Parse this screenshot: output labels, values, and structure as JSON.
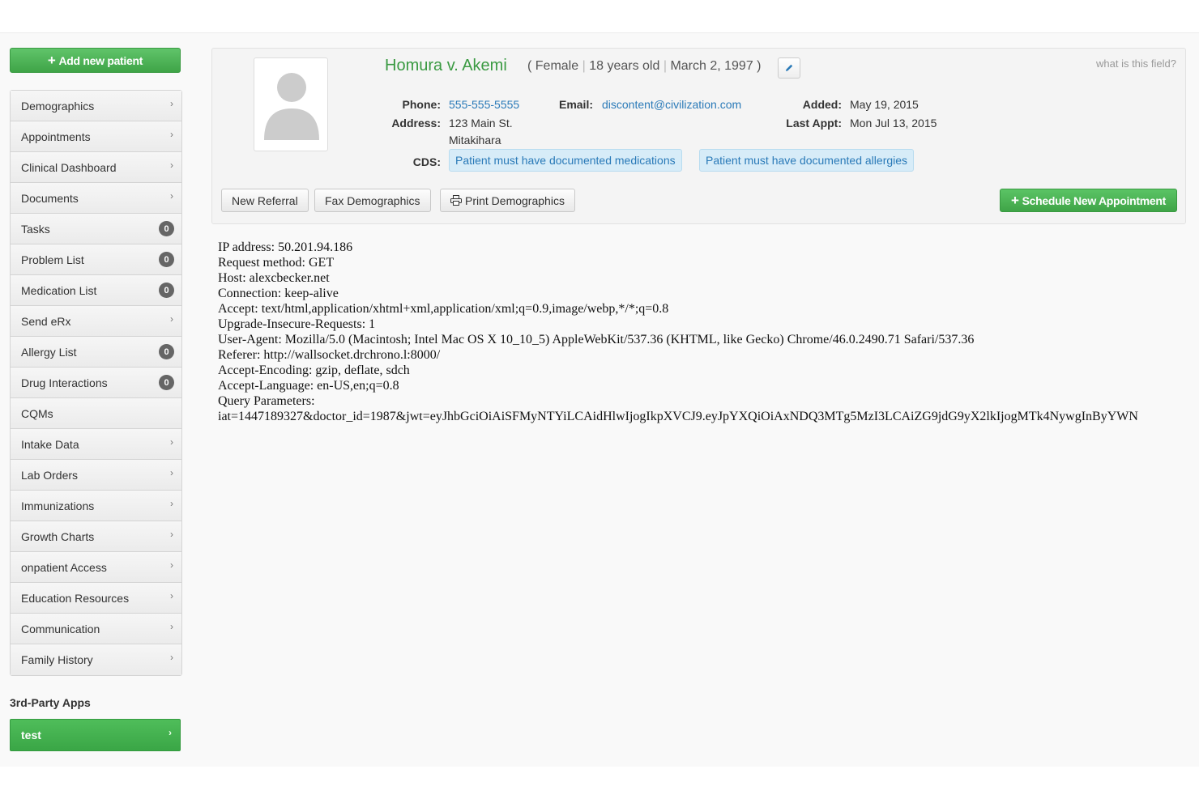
{
  "sidebar": {
    "add_patient_label": "Add new patient",
    "items": [
      {
        "label": "Demographics",
        "marker": "chevron"
      },
      {
        "label": "Appointments",
        "marker": "chevron"
      },
      {
        "label": "Clinical Dashboard",
        "marker": "chevron"
      },
      {
        "label": "Documents",
        "marker": "chevron"
      },
      {
        "label": "Tasks",
        "marker": "badge",
        "count": "0"
      },
      {
        "label": "Problem List",
        "marker": "badge",
        "count": "0"
      },
      {
        "label": "Medication List",
        "marker": "badge",
        "count": "0"
      },
      {
        "label": "Send eRx",
        "marker": "chevron"
      },
      {
        "label": "Allergy List",
        "marker": "badge",
        "count": "0"
      },
      {
        "label": "Drug Interactions",
        "marker": "badge",
        "count": "0"
      },
      {
        "label": "CQMs",
        "marker": "none"
      },
      {
        "label": "Intake Data",
        "marker": "chevron"
      },
      {
        "label": "Lab Orders",
        "marker": "chevron"
      },
      {
        "label": "Immunizations",
        "marker": "chevron"
      },
      {
        "label": "Growth Charts",
        "marker": "chevron"
      },
      {
        "label": "onpatient Access",
        "marker": "chevron"
      },
      {
        "label": "Education Resources",
        "marker": "chevron"
      },
      {
        "label": "Communication",
        "marker": "chevron"
      },
      {
        "label": "Family History",
        "marker": "chevron"
      }
    ],
    "third_party_title": "3rd-Party Apps",
    "third_party_item": "test"
  },
  "patient": {
    "name": "Homura v. Akemi",
    "open_paren": "(",
    "gender": "Female",
    "age": "18 years old",
    "dob": "March 2, 1997",
    "close_paren": ")",
    "what_field": "what is this field?",
    "phone_label": "Phone:",
    "phone": "555-555-5555",
    "email_label": "Email:",
    "email": "discontent@civilization.com",
    "added_label": "Added:",
    "added": "May 19, 2015",
    "address_label": "Address:",
    "address_line1": "123 Main St.",
    "address_line2": "Mitakihara",
    "last_appt_label": "Last Appt:",
    "last_appt": "Mon Jul 13, 2015",
    "cds_label": "CDS:",
    "cds_alerts": [
      "Patient must have documented medications",
      "Patient must have documented allergies"
    ]
  },
  "actions": {
    "new_referral": "New Referral",
    "fax_demographics": "Fax Demographics",
    "print_demographics": "Print Demographics",
    "schedule_appointment": "Schedule New Appointment"
  },
  "request_info": [
    "IP address: 50.201.94.186",
    "Request method: GET",
    "Host: alexcbecker.net",
    "Connection: keep-alive",
    "Accept: text/html,application/xhtml+xml,application/xml;q=0.9,image/webp,*/*;q=0.8",
    "Upgrade-Insecure-Requests: 1",
    "User-Agent: Mozilla/5.0 (Macintosh; Intel Mac OS X 10_10_5) AppleWebKit/537.36 (KHTML, like Gecko) Chrome/46.0.2490.71 Safari/537.36",
    "Referer: http://wallsocket.drchrono.l:8000/",
    "Accept-Encoding: gzip, deflate, sdch",
    "Accept-Language: en-US,en;q=0.8",
    "Query Parameters:",
    "iat=1447189327&doctor_id=1987&jwt=eyJhbGciOiAiSFMyNTYiLCAidHlwIjogIkpXVCJ9.eyJpYXQiOiAxNDQ3MTg5MzI3LCAiZG9jdG9yX2lkIjogMTk4NywgInByYWN"
  ],
  "colors": {
    "brand_green": "#3fa447",
    "name_green": "#3a9a42",
    "link_blue": "#2a7ab8",
    "cds_bg": "#d7ecf8",
    "badge_gray": "#666666"
  }
}
